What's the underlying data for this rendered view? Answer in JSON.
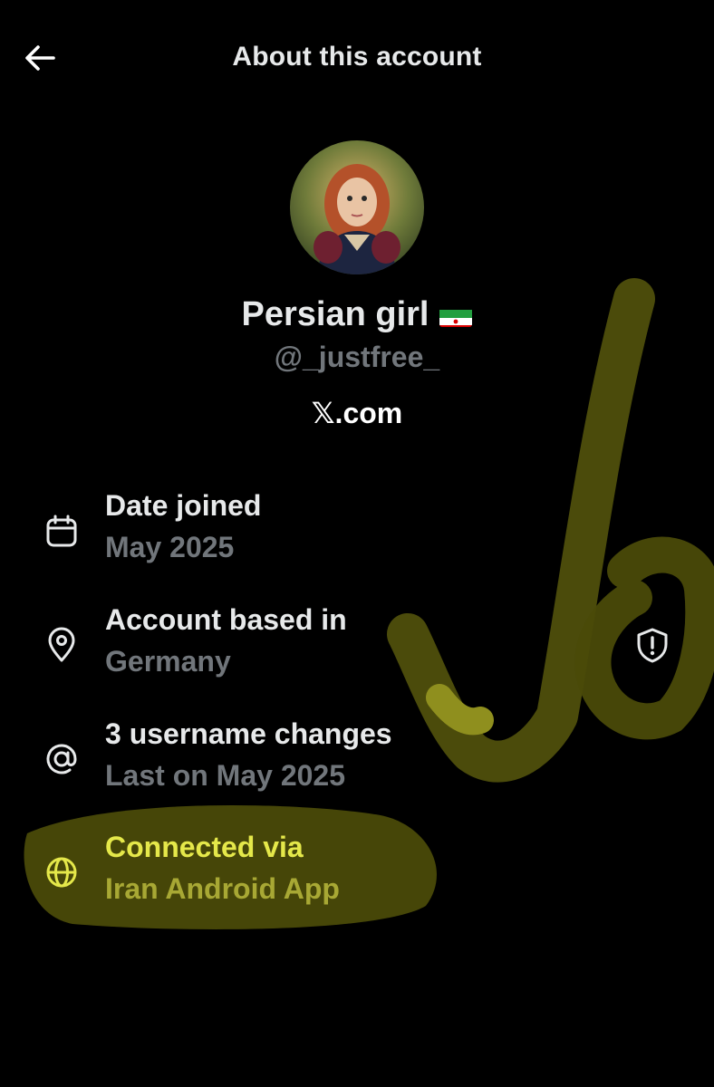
{
  "header": {
    "title": "About this account"
  },
  "profile": {
    "display_name": "Persian girl",
    "flag_icon": "iran-flag-icon",
    "handle": "@_justfree_",
    "platform": "𝕏.com"
  },
  "info": {
    "date_joined": {
      "icon": "calendar-icon",
      "title": "Date joined",
      "value": "May 2025"
    },
    "based_in": {
      "icon": "location-pin-icon",
      "title": "Account based in",
      "value": "Germany"
    },
    "username_changes": {
      "icon": "at-sign-icon",
      "title": "3 username changes",
      "value": "Last on May 2025"
    },
    "connected_via": {
      "icon": "globe-icon",
      "title": "Connected via",
      "value": "Iran Android App"
    }
  },
  "colors": {
    "background": "#000000",
    "primary_text": "#e7e9ea",
    "secondary_text": "#71767b",
    "highlight": "#e5e84a",
    "highlight_dim": "#a8a834",
    "marker": "#8f8f1e"
  }
}
